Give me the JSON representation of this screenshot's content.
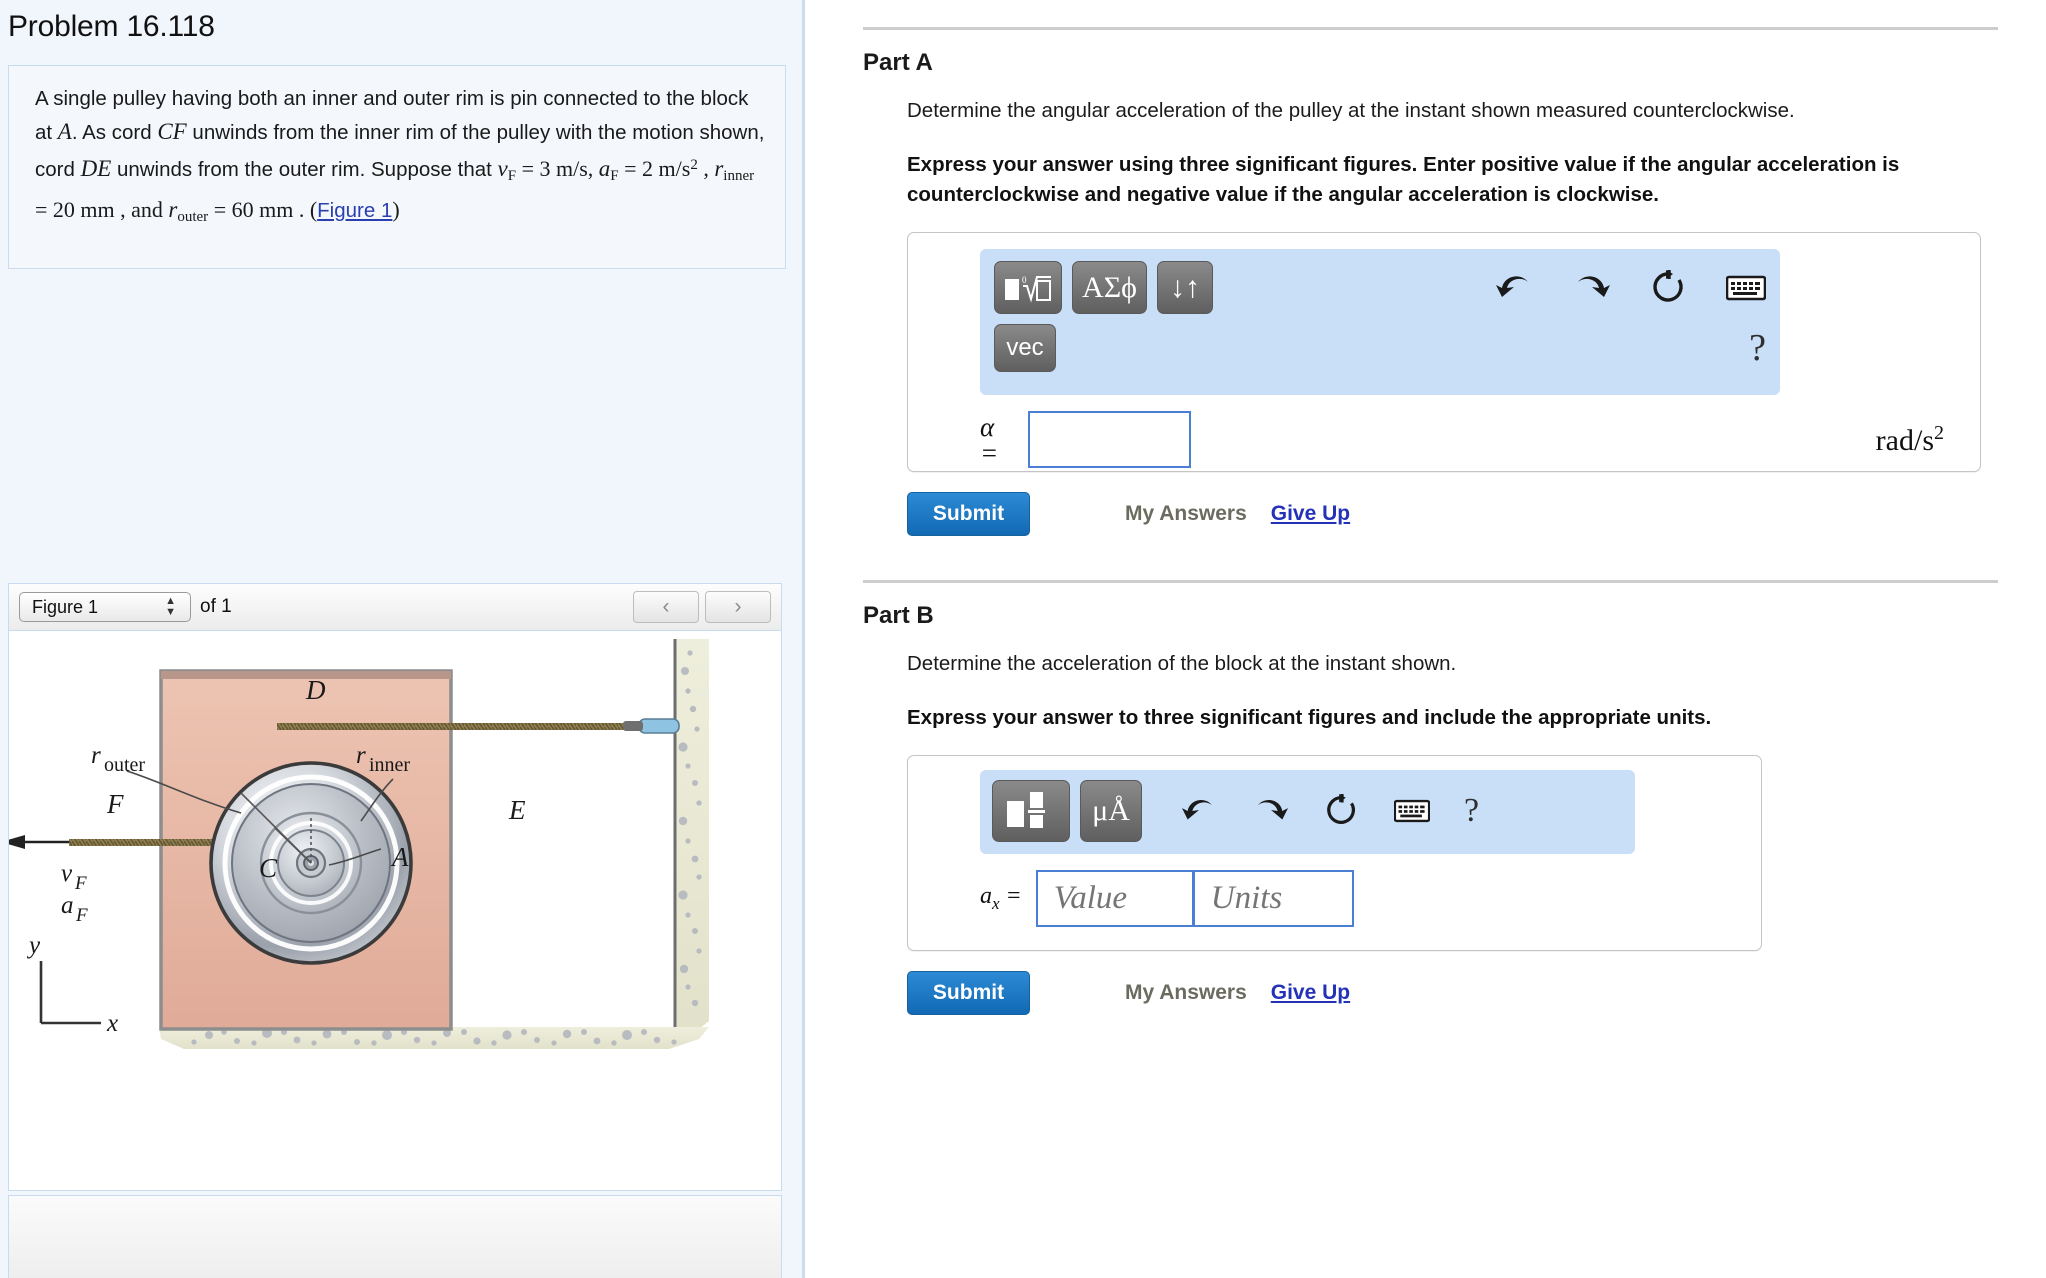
{
  "problem": {
    "title": "Problem 16.118",
    "statement_parts": {
      "s1": "A single pulley having both an inner and outer rim is pin connected to the block at ",
      "A": "A",
      "s2": ". As cord ",
      "CF": "CF",
      "s3": " unwinds from the inner rim of the pulley with the motion shown, cord ",
      "DE": "DE",
      "s4": " unwinds from the outer rim. Suppose that ",
      "v": "v",
      "v_sub": "F",
      "v_eq": " = 3 m/s, ",
      "a": "a",
      "a_sub": "F",
      "a_eq": " = 2  m/s",
      "a_sup": "2",
      "comma1": " , ",
      "r1": "r",
      "r1_sub": "inner",
      "r1_eq": " = 20  mm",
      "comma2": " , and ",
      "r2": "r",
      "r2_sub": "outer",
      "r2_eq": " = 60  mm . (",
      "figure_link": "Figure 1",
      "close": ")"
    }
  },
  "figure_nav": {
    "selected": "Figure 1",
    "of_label": "of 1",
    "prev_icon": "‹",
    "next_icon": "›"
  },
  "figure": {
    "labels": {
      "D": "D",
      "E": "E",
      "A": "A",
      "C": "C",
      "F": "F",
      "r_outer_main": "r",
      "r_outer_sub": "outer",
      "r_inner_main": "r",
      "r_inner_sub": "inner",
      "vF_main": "v",
      "vF_sub": "F",
      "aF_main": "a",
      "aF_sub": "F",
      "axis_y": "y",
      "axis_x": "x"
    },
    "colors": {
      "block": "#e8b9a8",
      "block_edge": "#8d8d8d",
      "ground": "#e7e7d2",
      "pulley_rim": "#c9cdd4",
      "pulley_body": "#b9bec6",
      "cord": "#8a7a4e",
      "anchor": "#8fc3e2"
    }
  },
  "parts": [
    {
      "id": "part-a",
      "heading": "Part A",
      "question": "Determine the angular acceleration of the pulley at the instant shown measured counterclockwise.",
      "instruction": "Express your answer using three significant figures. Enter positive value if the angular acceleration is counterclockwise and negative value if the angular acceleration is clockwise.",
      "toolbar": {
        "buttons": [
          {
            "name": "template-root-icon",
            "label": ""
          },
          {
            "name": "greek-symbols-button",
            "label": "ΑΣϕ"
          },
          {
            "name": "sort-arrows-button",
            "label": "↓↑"
          },
          {
            "name": "vec-button",
            "label": "vec"
          }
        ],
        "icons": [
          {
            "name": "undo-icon"
          },
          {
            "name": "redo-icon"
          },
          {
            "name": "reset-icon"
          },
          {
            "name": "keyboard-icon"
          }
        ],
        "help_label": "?"
      },
      "answer": {
        "symbol": "α",
        "equals": "=",
        "value": "",
        "placeholder": "",
        "units_label": "rad/s",
        "units_sup": "2"
      },
      "submit_label": "Submit",
      "my_answers_label": "My Answers",
      "give_up_label": "Give Up"
    },
    {
      "id": "part-b",
      "heading": "Part B",
      "question": "Determine the acceleration of the block at the instant shown.",
      "instruction": "Express your answer to three significant figures and include the appropriate units.",
      "toolbar": {
        "buttons": [
          {
            "name": "template-fraction-icon",
            "label": ""
          },
          {
            "name": "units-button",
            "label": "μÅ"
          }
        ],
        "icons": [
          {
            "name": "undo-icon"
          },
          {
            "name": "redo-icon"
          },
          {
            "name": "reset-icon"
          },
          {
            "name": "keyboard-icon"
          }
        ],
        "help_label": "?"
      },
      "answer": {
        "symbol_main": "a",
        "symbol_sub": "x",
        "equals": "=",
        "value": "",
        "value_placeholder": "Value",
        "units": "",
        "units_placeholder": "Units"
      },
      "submit_label": "Submit",
      "my_answers_label": "My Answers",
      "give_up_label": "Give Up"
    }
  ],
  "theme": {
    "accent_blue": "#1269b4",
    "link_blue": "#2432b8",
    "panel_bg": "#f1f6fd",
    "mathbar_bg": "#c9def7",
    "input_border": "#4a7fd4"
  }
}
